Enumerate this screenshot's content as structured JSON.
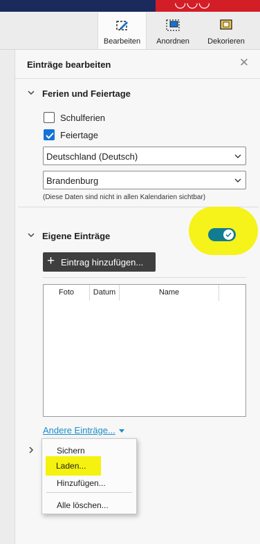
{
  "toolbar": {
    "tabs": [
      {
        "label": "Bearbeiten",
        "icon": "edit-layout-icon",
        "active": true
      },
      {
        "label": "Anordnen",
        "icon": "arrange-icon",
        "active": false
      },
      {
        "label": "Dekorieren",
        "icon": "decorate-icon",
        "active": false
      }
    ]
  },
  "panel": {
    "title": "Einträge bearbeiten",
    "holidays": {
      "title": "Ferien und Feiertage",
      "school_holidays": {
        "label": "Schulferien",
        "checked": false
      },
      "public_holidays": {
        "label": "Feiertage",
        "checked": true
      },
      "country_select": {
        "value": "Deutschland (Deutsch)"
      },
      "state_select": {
        "value": "Brandenburg"
      },
      "note": "(Diese Daten sind nicht in allen Kalendarien sichtbar)"
    },
    "own_entries": {
      "title": "Eigene Einträge",
      "toggle_on": true,
      "add_button": "Eintrag hinzufügen...",
      "table": {
        "columns": [
          "Foto",
          "Datum",
          "Name"
        ],
        "rows": []
      },
      "more_link": "Andere Einträge..."
    },
    "menu": {
      "items": [
        "Sichern",
        "Laden...",
        "Hinzufügen...",
        "Alle löschen..."
      ]
    }
  },
  "colors": {
    "topbar": "#1b2a5c",
    "brand_red": "#d31d27",
    "accent_blue": "#1473d6",
    "toggle_teal": "#127c92",
    "highlight_yellow": "#f4f20e",
    "link_blue": "#1a8fc9"
  }
}
